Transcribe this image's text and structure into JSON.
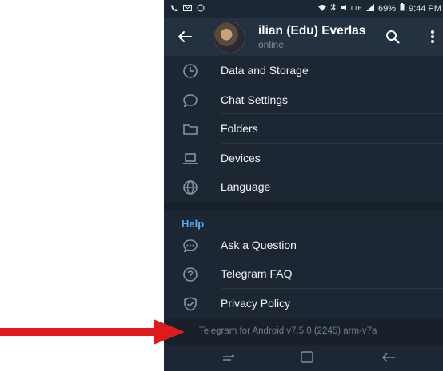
{
  "statusbar": {
    "battery_text": "69%",
    "time": "9:44 PM",
    "network": "LTE"
  },
  "header": {
    "title": "ilian (Edu) Everlas",
    "subtitle": "online"
  },
  "menu": {
    "items": [
      {
        "label": "Data and Storage",
        "icon": "clock-icon"
      },
      {
        "label": "Chat Settings",
        "icon": "chat-bubble-icon"
      },
      {
        "label": "Folders",
        "icon": "folder-icon"
      },
      {
        "label": "Devices",
        "icon": "laptop-icon"
      },
      {
        "label": "Language",
        "icon": "globe-icon"
      }
    ],
    "help_header": "Help",
    "help_items": [
      {
        "label": "Ask a Question",
        "icon": "chat-dots-icon"
      },
      {
        "label": "Telegram FAQ",
        "icon": "question-icon"
      },
      {
        "label": "Privacy Policy",
        "icon": "shield-check-icon"
      }
    ]
  },
  "footer": {
    "version": "Telegram for Android v7.5.0 (2245) arm-v7a"
  },
  "colors": {
    "background": "#1d2733",
    "accent": "#5aa9e6",
    "arrow": "#e11b1b"
  }
}
